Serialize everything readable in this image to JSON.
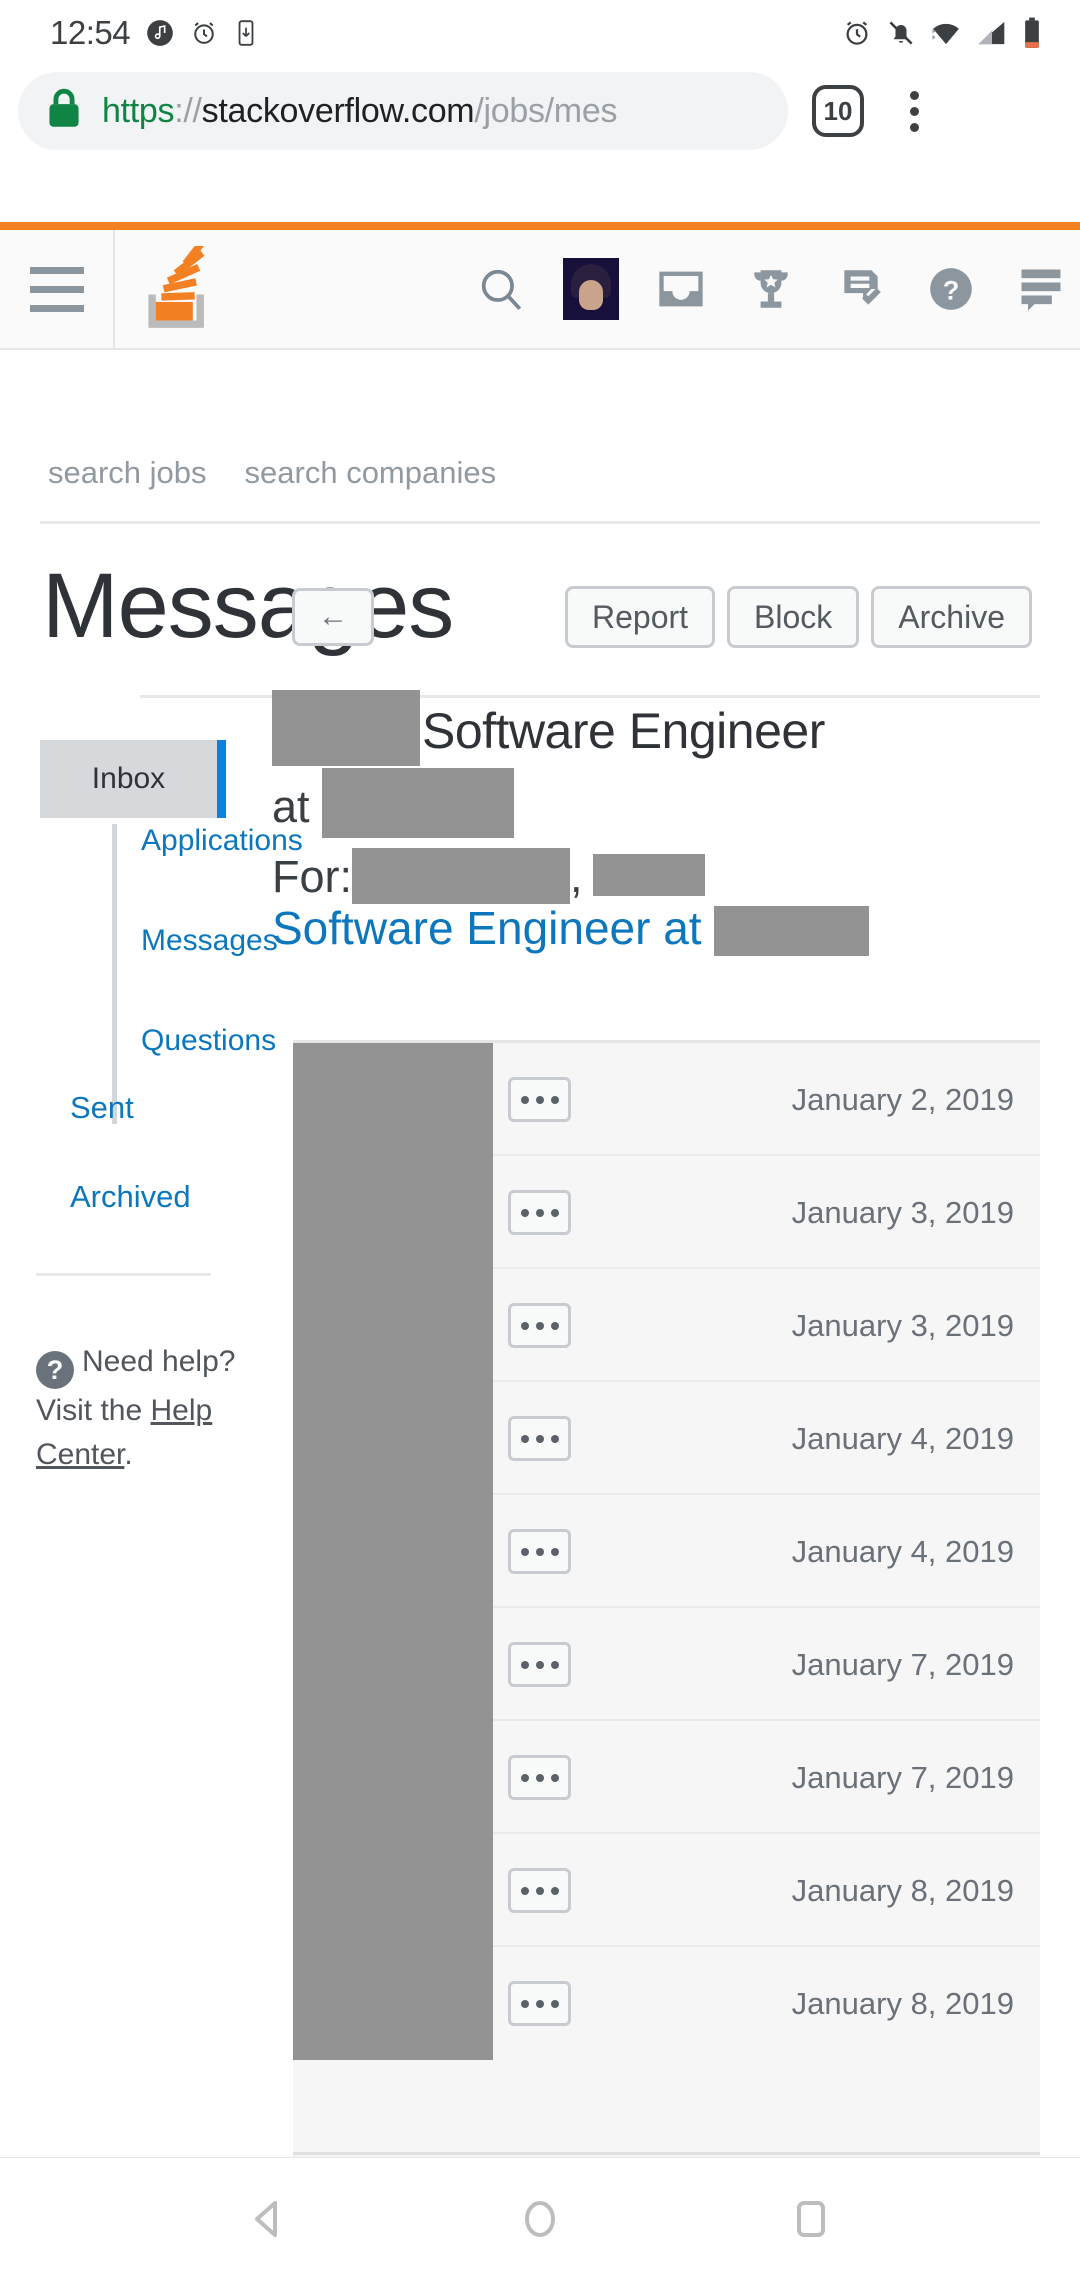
{
  "status_bar": {
    "time": "12:54",
    "left_icons": [
      "music-note-icon",
      "alarm-clock-icon",
      "vibrate-icon"
    ],
    "right_icons": [
      "alarm-clock-icon",
      "notifications-off-icon",
      "wifi-icon",
      "cell-signal-icon",
      "battery-icon"
    ]
  },
  "browser": {
    "lock_icon": "lock-icon",
    "url_scheme": "https",
    "url_sep": "://",
    "url_host": "stackoverflow.com",
    "url_path": "/jobs/mes",
    "tab_count": "10",
    "menu_icon": "overflow-menu-icon"
  },
  "site_nav": {
    "accent_color": "#f48024",
    "menu_icon": "hamburger-menu-icon",
    "logo": "stack-overflow-logo",
    "icons": [
      "search-icon",
      "user-avatar",
      "inbox-icon",
      "achievements-trophy-icon",
      "review-queues-icon",
      "help-circle-icon",
      "chat-icon"
    ]
  },
  "jobs_nav": {
    "items": [
      {
        "label": "search jobs"
      },
      {
        "label": "search companies"
      }
    ]
  },
  "header": {
    "title": "Messages",
    "back_label": "←",
    "actions": [
      {
        "label": "Report"
      },
      {
        "label": "Block"
      },
      {
        "label": "Archive"
      }
    ]
  },
  "sidebar": {
    "inbox_label": "Inbox",
    "sub_items": [
      {
        "label": "Applications"
      },
      {
        "label": "Messages"
      },
      {
        "label": "Questions"
      }
    ],
    "root_items": [
      {
        "label": "Sent"
      },
      {
        "label": "Archived"
      }
    ],
    "help": {
      "icon": "help-circle-icon",
      "text_before": "Need help? Visit the ",
      "link_label": "Help Center",
      "text_after": "."
    }
  },
  "conversation": {
    "line1_redacted": "[redacted-name]",
    "line1_text": "Software Engineer",
    "line2_prefix": "at ",
    "line2_redacted": "[redacted-company]",
    "for_label": "For:",
    "for_redacted_1": "[redacted-name]",
    "for_comma": ",",
    "for_redacted_2": "[redacted-name]",
    "job_link_text": "Software Engineer at ",
    "job_link_redacted": "[redacted-company]"
  },
  "messages": {
    "more_button_label": "•••",
    "rows": [
      {
        "sender": "[redacted]",
        "date": "January 2, 2019"
      },
      {
        "sender": "[redacted]",
        "date": "January 3, 2019"
      },
      {
        "sender": "[redacted]",
        "date": "January 3, 2019"
      },
      {
        "sender": "[redacted]",
        "date": "January 4, 2019"
      },
      {
        "sender": "[redacted]",
        "date": "January 4, 2019"
      },
      {
        "sender": "[redacted]",
        "date": "January 7, 2019"
      },
      {
        "sender": "[redacted]",
        "date": "January 7, 2019"
      },
      {
        "sender": "[redacted]",
        "date": "January 8, 2019"
      },
      {
        "sender": "[redacted]",
        "date": "January 8, 2019"
      }
    ]
  },
  "android_nav": {
    "back_icon": "back-triangle-icon",
    "home_icon": "home-circle-icon",
    "recents_icon": "recents-square-icon"
  }
}
